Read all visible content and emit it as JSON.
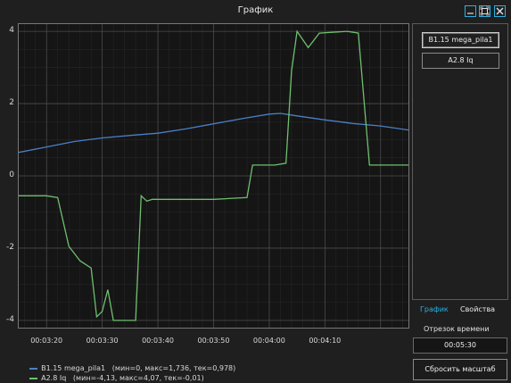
{
  "window": {
    "title": "График"
  },
  "controls": {
    "minimize_icon": "minimize-icon",
    "maximize_icon": "maximize-icon",
    "close_icon": "close-icon"
  },
  "sidebar": {
    "signals": [
      {
        "label": "B1.15 mega_pila1",
        "selected": true
      },
      {
        "label": "A2.8 Iq",
        "selected": false
      }
    ],
    "tabs": [
      {
        "label": "График",
        "active": true,
        "color": "#2ab0e0"
      },
      {
        "label": "Свойства",
        "active": false,
        "color": "#e8e8e8"
      }
    ],
    "time_label": "Отрезок времени",
    "time_value": "00:05:30",
    "reset_label": "Сбросить масштаб"
  },
  "legend": [
    {
      "name": "B1.15 mega_pila1",
      "stats": "(мин=0, макс=1,736, тек=0,978)",
      "color": "#4a7fc8"
    },
    {
      "name": "A2.8 Iq",
      "stats": "(мин=-4,13, макс=4,07, тек=-0,01)",
      "color": "#6fbf6f"
    }
  ],
  "chart_data": {
    "type": "line",
    "x_ticks": [
      "00:03:20",
      "00:03:30",
      "00:03:40",
      "00:03:50",
      "00:04:00",
      "00:04:10"
    ],
    "y_ticks": [
      "4",
      "2",
      "0",
      "-2",
      "-4"
    ],
    "xlim_seconds": [
      195,
      265
    ],
    "ylim": [
      -4.2,
      4.2
    ],
    "grid": true,
    "series": [
      {
        "name": "B1.15 mega_pila1",
        "color": "#4a7fc8",
        "points": [
          [
            195,
            0.65
          ],
          [
            200,
            0.8
          ],
          [
            205,
            0.95
          ],
          [
            210,
            1.05
          ],
          [
            215,
            1.12
          ],
          [
            220,
            1.18
          ],
          [
            225,
            1.3
          ],
          [
            230,
            1.44
          ],
          [
            235,
            1.58
          ],
          [
            240,
            1.71
          ],
          [
            242,
            1.73
          ],
          [
            245,
            1.66
          ],
          [
            250,
            1.55
          ],
          [
            255,
            1.45
          ],
          [
            260,
            1.38
          ],
          [
            265,
            1.27
          ],
          [
            270,
            1.1
          ],
          [
            272,
            1.0
          ],
          [
            275,
            0.98
          ]
        ]
      },
      {
        "name": "A2.8 Iq",
        "color": "#6fbf6f",
        "points": [
          [
            195,
            -0.55
          ],
          [
            200,
            -0.55
          ],
          [
            202,
            -0.6
          ],
          [
            204,
            -1.95
          ],
          [
            206,
            -2.35
          ],
          [
            208,
            -2.55
          ],
          [
            209,
            -3.9
          ],
          [
            210,
            -3.75
          ],
          [
            211,
            -3.15
          ],
          [
            212,
            -4.0
          ],
          [
            214,
            -4.0
          ],
          [
            216,
            -4.0
          ],
          [
            217,
            -0.55
          ],
          [
            218,
            -0.7
          ],
          [
            219,
            -0.65
          ],
          [
            225,
            -0.65
          ],
          [
            230,
            -0.65
          ],
          [
            236,
            -0.6
          ],
          [
            237,
            0.3
          ],
          [
            241,
            0.3
          ],
          [
            243,
            0.35
          ],
          [
            244,
            2.9
          ],
          [
            245,
            4.0
          ],
          [
            247,
            3.55
          ],
          [
            249,
            3.95
          ],
          [
            254,
            4.0
          ],
          [
            256,
            3.95
          ],
          [
            258,
            0.3
          ],
          [
            262,
            0.3
          ],
          [
            266,
            0.3
          ],
          [
            268,
            0.1
          ],
          [
            271,
            -0.01
          ],
          [
            275,
            -0.01
          ]
        ]
      }
    ]
  }
}
